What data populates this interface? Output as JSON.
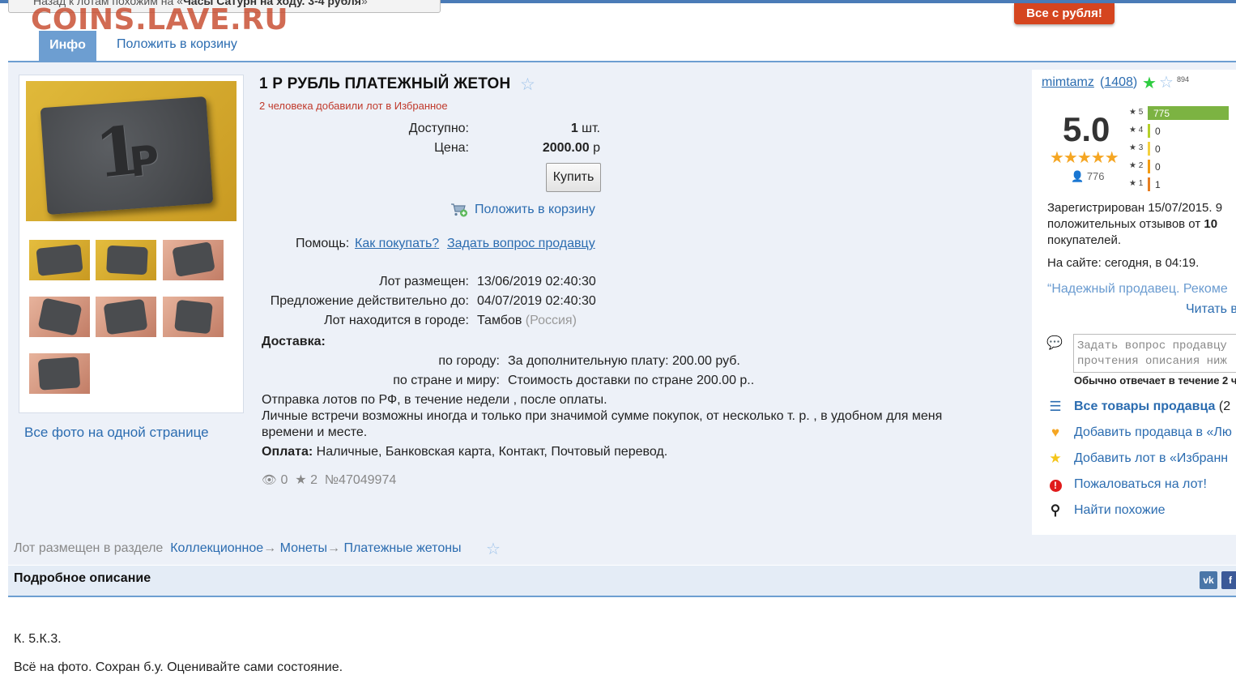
{
  "header": {
    "back_link_prefix": "Назад к лотам похожим на «",
    "back_link_bold": "Часы Сатурн на ходу. 3-4 рубля",
    "back_link_suffix": "»",
    "watermark": "COINS.LAVE.RU",
    "all_from_ruble": "Все с рубля!"
  },
  "tabs": {
    "info": "Инфо",
    "cart": "Положить в корзину"
  },
  "lot": {
    "title": "1 Р РУБЛЬ ПЛАТЕЖНЫЙ ЖЕТОН",
    "fav_note": "2 человека добавили лот в Избранное",
    "available_label": "Доступно:",
    "available_value": "1",
    "available_unit": " шт.",
    "price_label": "Цена:",
    "price_value": "2000.00",
    "price_unit": " р",
    "buy_button": "Купить",
    "cart_link": "Положить в корзину",
    "help_label": "Помощь:",
    "help_how_to_buy": "Как покупать?",
    "help_ask_seller": "Задать вопрос продавцу",
    "posted_label": "Лот размещен:",
    "posted_value": "13/06/2019 02:40:30",
    "valid_label": "Предложение действительно до:",
    "valid_value": "04/07/2019 02:40:30",
    "city_label": "Лот находится в городе:",
    "city_value": "Тамбов",
    "country_value": "(Россия)",
    "delivery_label": "Доставка:",
    "delivery_city_label": "по городу:",
    "delivery_city_value": "За дополнительную плату: 200.00 руб.",
    "delivery_world_label": "по стране и миру:",
    "delivery_world_value": "Стоимость доставки по стране 200.00 р..",
    "shipping_note_1": "Отправка лотов по РФ, в течение недели , после оплаты.",
    "shipping_note_2": "Личные встречи возможны иногда и только при значимой сумме покупок, от несколько т. р. , в удобном для меня",
    "shipping_note_3": "времени и месте.",
    "payment_label": "Оплата:",
    "payment_value": " Наличные, Банковская карта, Контакт, Почтовый перевод.",
    "views": "0",
    "favorites": "2",
    "lot_number": "№47049974",
    "all_photos": "Все фото на одной странице"
  },
  "seller": {
    "name": "mimtamz",
    "count_open": " (",
    "count": "1408",
    "count_close": ")",
    "badge_count": "894",
    "rating": "5.0",
    "votes": "776",
    "bars": [
      {
        "star": "5",
        "count": "775",
        "color": "#7cb342",
        "fraction": 1.0
      },
      {
        "star": "4",
        "count": "0",
        "color": "#b5cf2b",
        "fraction": 0
      },
      {
        "star": "3",
        "count": "0",
        "color": "#f4d03f",
        "fraction": 0
      },
      {
        "star": "2",
        "count": "0",
        "color": "#f39c12",
        "fraction": 0
      },
      {
        "star": "1",
        "count": "1",
        "color": "#e67e22",
        "fraction": 0.002
      }
    ],
    "registered_1": "Зарегистрирован 15/07/2015. 9",
    "registered_2_prefix": "положительных отзывов от ",
    "registered_2_bold": "10",
    "registered_3": "покупателей.",
    "online": "На сайте: сегодня, в 04:19.",
    "review_quote": "“Надежный продавец. Рекоме",
    "read_more": "Читать в",
    "ask_placeholder": "Задать вопрос продавцу\nпрочтения описания ниж",
    "reply_time": "Обычно отвечает в течение 2 ч",
    "all_goods": "Все товары продавца",
    "all_goods_suffix": " (2",
    "add_favorite_seller": "Добавить продавца в «Лю",
    "add_favorite_lot": "Добавить лот в «Избранн",
    "complain": "Пожаловаться на лот!",
    "find_similar": "Найти похожие"
  },
  "category": {
    "prefix": "Лот размещен в разделе",
    "level1": "Коллекционное",
    "level2": "Монеты",
    "level3": "Платежные жетоны",
    "arrow": "→"
  },
  "description": {
    "title": "Подробное описание",
    "text1": "К. 5.К.3.",
    "text2": "Всё на фото. Сохран б.у. Оценивайте сами состояние."
  },
  "share": {
    "vk": "vk",
    "fb": "f"
  }
}
